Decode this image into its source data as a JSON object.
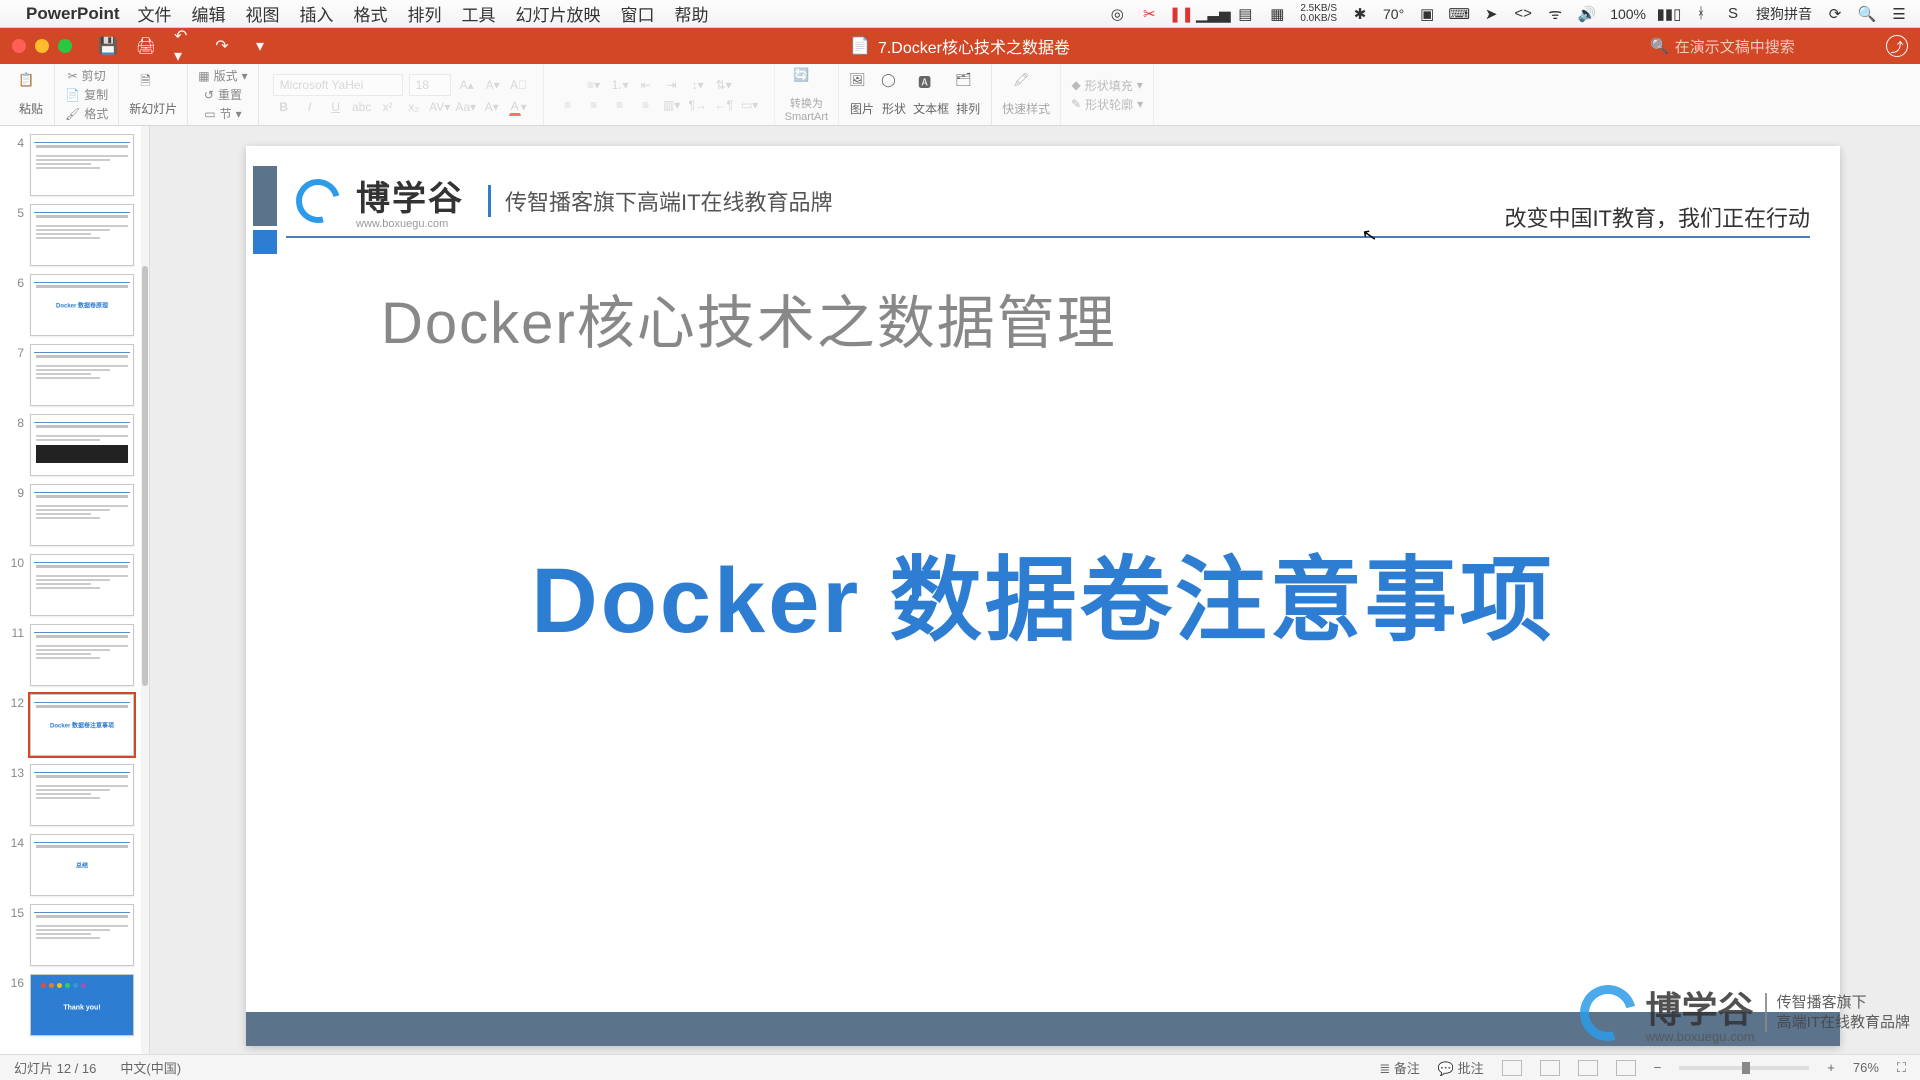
{
  "menubar": {
    "app": "PowerPoint",
    "items": [
      "文件",
      "编辑",
      "视图",
      "插入",
      "格式",
      "排列",
      "工具",
      "幻灯片放映",
      "窗口",
      "帮助"
    ],
    "right": {
      "net_up": "2.5KB/S",
      "net_down": "0.0KB/S",
      "temp": "70°",
      "battery": "100%",
      "ime": "搜狗拼音"
    }
  },
  "titlebar": {
    "doc": "7.Docker核心技术之数据卷",
    "search_placeholder": "在演示文稿中搜索"
  },
  "ribbon": {
    "paste": "粘贴",
    "cut": "剪切",
    "copy": "复制",
    "format": "格式",
    "new_slide": "新幻灯片",
    "layout": "版式",
    "reset": "重置",
    "section": "节",
    "font_name": "Microsoft YaHei",
    "font_size": "18",
    "convert_smartart": "转换为\nSmartArt",
    "pictures": "图片",
    "shapes": "形状",
    "textbox": "文本框",
    "arrange": "排列",
    "quick_styles": "快速样式",
    "shape_fill": "形状填充",
    "shape_outline": "形状轮廓"
  },
  "thumbs": {
    "start": 4,
    "end": 16,
    "selected": 12,
    "blue_text_slides": {
      "6": "Docker 数据卷原理",
      "12": "Docker 数据卷注意事项",
      "14": "总结"
    }
  },
  "slide": {
    "logo_text": "博学谷",
    "logo_sub": "www.boxuegu.com",
    "tagline": "传智播客旗下高端IT在线教育品牌",
    "header_right": "改变中国IT教育，我们正在行动",
    "subtitle": "Docker核心技术之数据管理",
    "main_title": "Docker 数据卷注意事项"
  },
  "watermark": {
    "text": "博学谷",
    "sub": "www.boxuegu.com",
    "side1": "传智播客旗下",
    "side2": "高端IT在线教育品牌"
  },
  "status": {
    "slide_info": "幻灯片 12 / 16",
    "lang": "中文(中国)",
    "notes": "备注",
    "comments": "批注",
    "zoom": "76%"
  }
}
